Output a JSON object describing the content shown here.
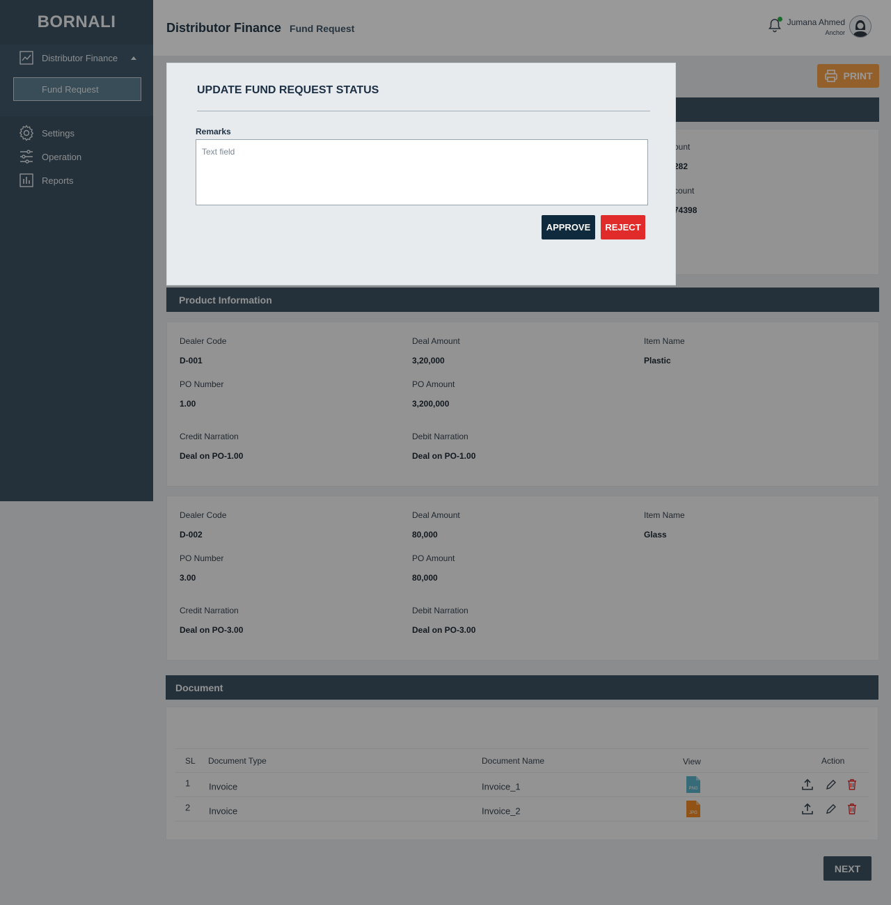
{
  "sidebar": {
    "brand": "BORNALI",
    "menu": {
      "parent_label": "Distributor Finance",
      "sub_label": "Fund Request"
    },
    "items": [
      {
        "label": "Settings",
        "icon": "gear-icon"
      },
      {
        "label": "Operation",
        "icon": "sliders-icon"
      },
      {
        "label": "Reports",
        "icon": "bar-chart-icon"
      }
    ]
  },
  "header": {
    "title": "Distributor Finance",
    "subtitle": "Fund Request",
    "user_name": "Jumana Ahmed",
    "user_role": "Anchor"
  },
  "toolbar": {
    "print_label": "PRINT"
  },
  "partial_fields": {
    "label_1": "ount",
    "value_1": "282",
    "label_2": "count",
    "value_2": "74398"
  },
  "product_section": {
    "title": "Product Information"
  },
  "products": [
    {
      "dealer_code_label": "Dealer Code",
      "dealer_code": "D-001",
      "deal_amount_label": "Deal Amount",
      "deal_amount": "3,20,000",
      "item_name_label": "Item Name",
      "item_name": "Plastic",
      "po_number_label": "PO Number",
      "po_number": "1.00",
      "po_amount_label": "PO Amount",
      "po_amount": "3,200,000",
      "credit_narration_label": "Credit Narration",
      "credit_narration": "Deal on PO-1.00",
      "debit_narration_label": "Debit Narration",
      "debit_narration": "Deal on PO-1.00"
    },
    {
      "dealer_code_label": "Dealer Code",
      "dealer_code": "D-002",
      "deal_amount_label": "Deal Amount",
      "deal_amount": "80,000",
      "item_name_label": "Item Name",
      "item_name": "Glass",
      "po_number_label": "PO Number",
      "po_number": "3.00",
      "po_amount_label": "PO Amount",
      "po_amount": "80,000",
      "credit_narration_label": "Credit Narration",
      "credit_narration": "Deal on PO-3.00",
      "debit_narration_label": "Debit Narration",
      "debit_narration": "Deal on PO-3.00"
    }
  ],
  "documents": {
    "title": "Document",
    "columns": {
      "sl": "SL",
      "type": "Document Type",
      "name": "Document Name",
      "view": "View",
      "action": "Action"
    },
    "rows": [
      {
        "sl": "1",
        "type": "Invoice",
        "name": "Invoice_1",
        "file_badge": "PNG",
        "file_color": "#5bb3c9"
      },
      {
        "sl": "2",
        "type": "Invoice",
        "name": "Invoice_2",
        "file_badge": "JPG",
        "file_color": "#f08a24"
      }
    ]
  },
  "footer": {
    "next_label": "NEXT"
  },
  "modal": {
    "title": "UPDATE FUND REQUEST STATUS",
    "remarks_label": "Remarks",
    "remarks_placeholder": "Text field",
    "remarks_value": "",
    "approve_label": "APPROVE",
    "reject_label": "REJECT"
  },
  "colors": {
    "sidebar": "#3e5261",
    "section_header": "#3e5261",
    "print_button": "#f5a04a",
    "approve_button": "#0e2a3c",
    "reject_button": "#e12a2a",
    "online_indicator": "#2bb34a"
  }
}
